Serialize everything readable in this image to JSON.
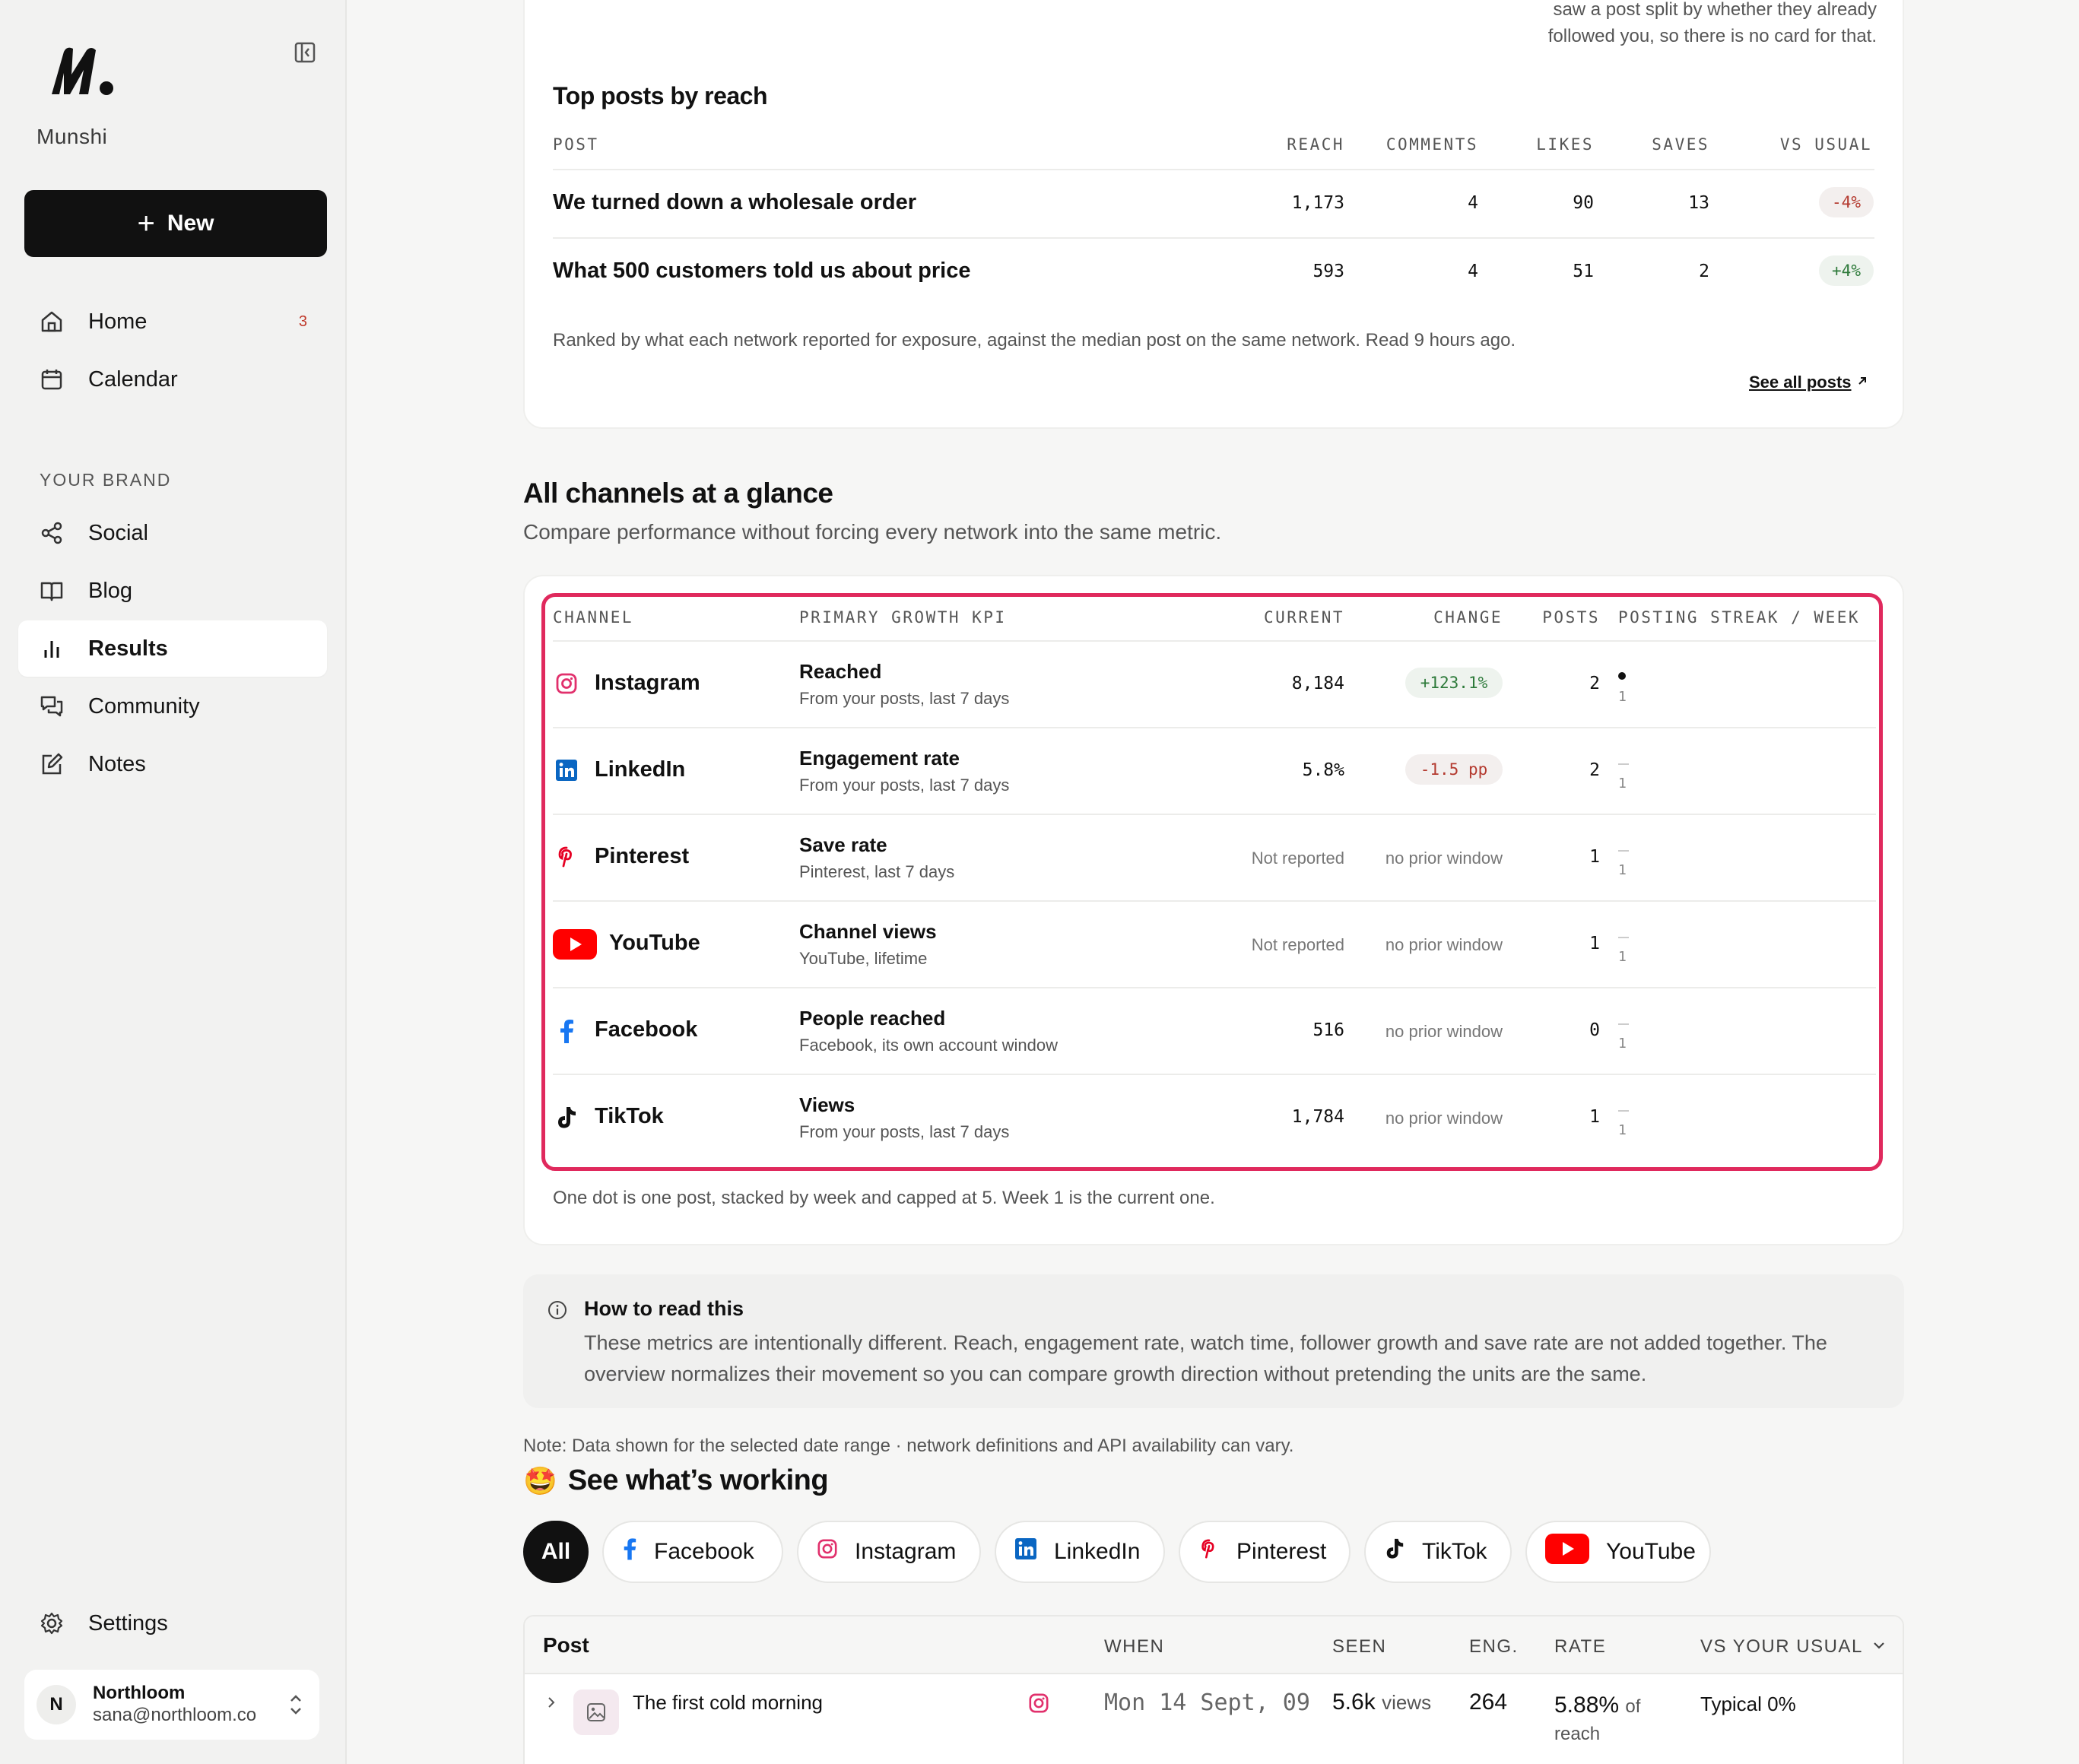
{
  "sidebar": {
    "brand": "Munshi",
    "new_label": "New",
    "nav": [
      {
        "label": "Home",
        "count": "3"
      },
      {
        "label": "Calendar"
      }
    ],
    "section_label": "YOUR BRAND",
    "brand_nav": [
      {
        "label": "Social"
      },
      {
        "label": "Blog"
      },
      {
        "label": "Results"
      },
      {
        "label": "Community"
      },
      {
        "label": "Notes"
      }
    ],
    "settings_label": "Settings",
    "account": {
      "initial": "N",
      "name": "Northloom",
      "email": "sana@northloom.co"
    }
  },
  "top_note": "saw a post split by whether they already followed you, so there is no card for that.",
  "top_posts": {
    "title": "Top posts by reach",
    "columns": [
      "POST",
      "REACH",
      "COMMENTS",
      "LIKES",
      "SAVES",
      "VS USUAL"
    ],
    "rows": [
      {
        "post": "We turned down a wholesale order",
        "reach": "1,173",
        "comments": "4",
        "likes": "90",
        "saves": "13",
        "vs_usual": "-4%"
      },
      {
        "post": "What 500 customers told us about price",
        "reach": "593",
        "comments": "4",
        "likes": "51",
        "saves": "2",
        "vs_usual": "+4%"
      }
    ],
    "caption": "Ranked by what each network reported for exposure, against the median post on the same network. Read 9 hours ago.",
    "see_all": "See all posts"
  },
  "channels": {
    "title": "All channels at a glance",
    "subtitle": "Compare performance without forcing every network into the same metric.",
    "columns": [
      "CHANNEL",
      "PRIMARY GROWTH KPI",
      "CURRENT",
      "CHANGE",
      "POSTS",
      "POSTING STREAK / WEEK"
    ],
    "rows": [
      {
        "channel": "Instagram",
        "kpi": "Reached",
        "kpi_sub": "From your posts, last 7 days",
        "current": "8,184",
        "change": "+123.1%",
        "posts": "2",
        "streak_week": "1"
      },
      {
        "channel": "LinkedIn",
        "kpi": "Engagement rate",
        "kpi_sub": "From your posts, last 7 days",
        "current": "5.8%",
        "change": "-1.5 pp",
        "posts": "2",
        "streak_week": "1"
      },
      {
        "channel": "Pinterest",
        "kpi": "Save rate",
        "kpi_sub": "Pinterest, last 7 days",
        "current": "Not reported",
        "change": "no prior window",
        "posts": "1",
        "streak_week": "1"
      },
      {
        "channel": "YouTube",
        "kpi": "Channel views",
        "kpi_sub": "YouTube, lifetime",
        "current": "Not reported",
        "change": "no prior window",
        "posts": "1",
        "streak_week": "1"
      },
      {
        "channel": "Facebook",
        "kpi": "People reached",
        "kpi_sub": "Facebook, its own account window",
        "current": "516",
        "change": "no prior window",
        "posts": "0",
        "streak_week": "1"
      },
      {
        "channel": "TikTok",
        "kpi": "Views",
        "kpi_sub": "From your posts, last 7 days",
        "current": "1,784",
        "change": "no prior window",
        "posts": "1",
        "streak_week": "1"
      }
    ],
    "caption": "One dot is one post, stacked by week and capped at 5. Week 1 is the current one."
  },
  "how_to_read": {
    "title": "How to read this",
    "body": "These metrics are intentionally different. Reach, engagement rate, watch time, follower growth and save rate are not added together. The overview normalizes their movement so you can compare growth direction without pretending the units are the same."
  },
  "note": "Note: Data shown for the selected date range · network definitions and API availability can vary.",
  "working": {
    "emoji": "🤩",
    "title": "See what’s working",
    "filters": [
      "All",
      "Facebook",
      "Instagram",
      "LinkedIn",
      "Pinterest",
      "TikTok",
      "YouTube"
    ],
    "columns": [
      "Post",
      "WHEN",
      "SEEN",
      "ENG.",
      "RATE",
      "VS YOUR USUAL"
    ],
    "rows": [
      {
        "post": "The first cold morning",
        "when": "Mon 14 Sept, 09",
        "seen": "5.6k",
        "seen_unit": "views",
        "eng": "264",
        "rate": "5.88%",
        "rate_unit": "of",
        "rate_unit2": "reach",
        "vs": "Typical 0%"
      }
    ]
  },
  "colors": {
    "highlight": "#e0295d",
    "instagram": "#e1306c",
    "linkedin": "#0a66c2",
    "pinterest": "#e60023",
    "youtube": "#ff0000",
    "facebook": "#1877f2"
  }
}
